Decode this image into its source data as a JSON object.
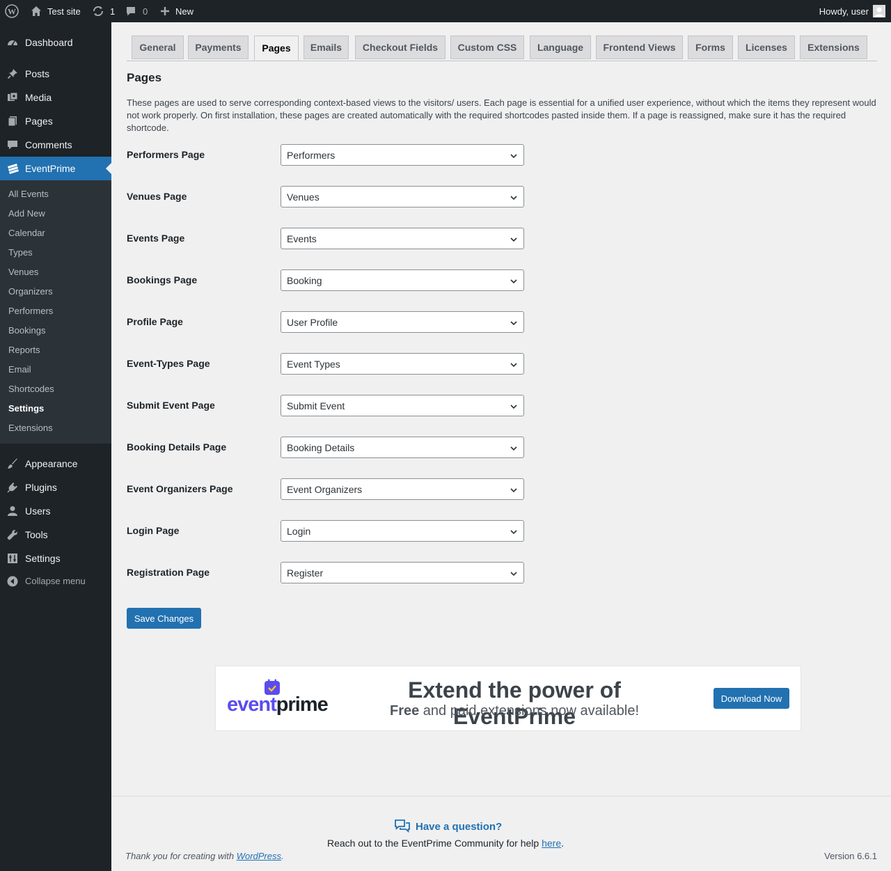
{
  "admin_bar": {
    "site_name": "Test site",
    "updates_count": "1",
    "comments_count": "0",
    "new_label": "New",
    "greeting": "Howdy, user"
  },
  "sidebar": {
    "menu": [
      {
        "label": "Dashboard",
        "icon": "dashboard-icon"
      },
      {
        "label": "Posts",
        "icon": "pin-icon"
      },
      {
        "label": "Media",
        "icon": "media-icon"
      },
      {
        "label": "Pages",
        "icon": "pages-icon"
      },
      {
        "label": "Comments",
        "icon": "comments-icon"
      },
      {
        "label": "EventPrime",
        "icon": "eventprime-icon"
      }
    ],
    "submenu": [
      "All Events",
      "Add New",
      "Calendar",
      "Types",
      "Venues",
      "Organizers",
      "Performers",
      "Bookings",
      "Reports",
      "Email",
      "Shortcodes",
      "Settings",
      "Extensions"
    ],
    "menu2": [
      {
        "label": "Appearance",
        "icon": "brush-icon"
      },
      {
        "label": "Plugins",
        "icon": "plug-icon"
      },
      {
        "label": "Users",
        "icon": "user-icon"
      },
      {
        "label": "Tools",
        "icon": "wrench-icon"
      },
      {
        "label": "Settings",
        "icon": "sliders-icon"
      }
    ],
    "collapse_label": "Collapse menu"
  },
  "tabs": [
    "General",
    "Payments",
    "Pages",
    "Emails",
    "Checkout Fields",
    "Custom CSS",
    "Language",
    "Frontend Views",
    "Forms",
    "Licenses",
    "Extensions"
  ],
  "active_tab": "Pages",
  "page": {
    "title": "Pages",
    "description": "These pages are used to serve corresponding context-based views to the visitors/ users. Each page is essential for a unified user experience, without which the items they represent would not work properly. On first installation, these pages are created automatically with the required shortcodes pasted inside them. If a page is reassigned, make sure it has the required shortcode."
  },
  "fields": [
    {
      "label": "Performers Page",
      "value": "Performers"
    },
    {
      "label": "Venues Page",
      "value": "Venues"
    },
    {
      "label": "Events Page",
      "value": "Events"
    },
    {
      "label": "Bookings Page",
      "value": "Booking"
    },
    {
      "label": "Profile Page",
      "value": "User Profile"
    },
    {
      "label": "Event-Types Page",
      "value": "Event Types"
    },
    {
      "label": "Submit Event Page",
      "value": "Submit Event"
    },
    {
      "label": "Booking Details Page",
      "value": "Booking Details"
    },
    {
      "label": "Event Organizers Page",
      "value": "Event Organizers"
    },
    {
      "label": "Login Page",
      "value": "Login"
    },
    {
      "label": "Registration Page",
      "value": "Register"
    }
  ],
  "save_label": "Save Changes",
  "banner": {
    "logo_text_a": "event",
    "logo_text_b": "prime",
    "headline": "Extend the power of EventPrime",
    "sub_bold": "Free",
    "sub_rest": " and paid extensions now available!",
    "button": "Download Now"
  },
  "footer": {
    "question": "Have a question?",
    "reach_text": "Reach out to the EventPrime Community for help ",
    "reach_link": "here",
    "thanks_text": "Thank you for creating with ",
    "thanks_link": "WordPress",
    "version": "Version 6.6.1"
  },
  "colors": {
    "admin_dark": "#1d2327",
    "accent": "#2271b1",
    "logo_purple": "#5b4cf0"
  }
}
